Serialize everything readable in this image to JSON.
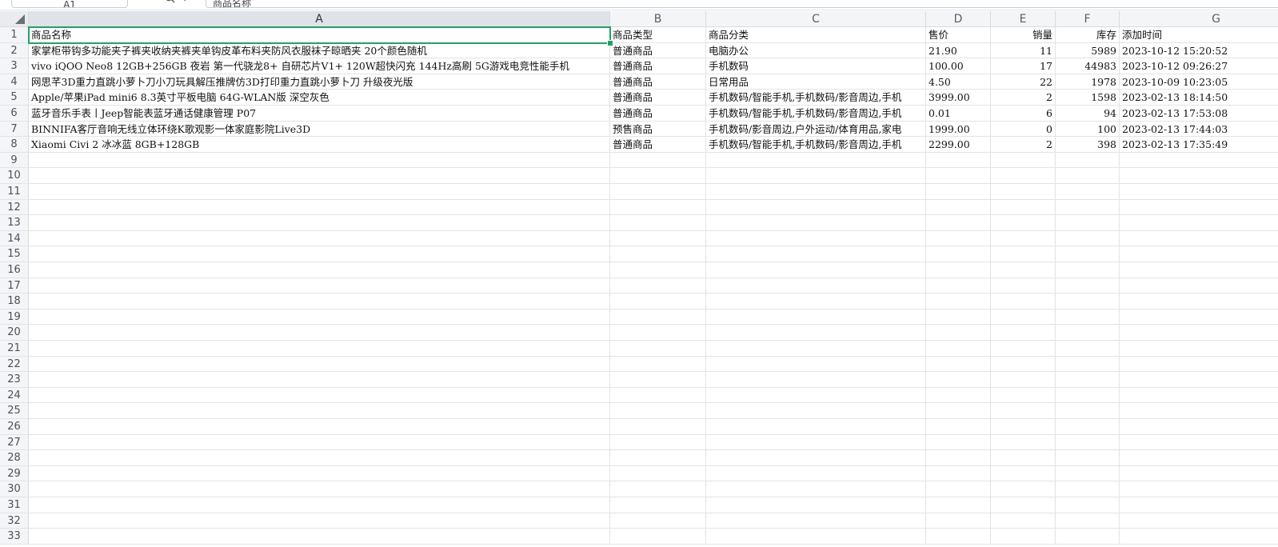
{
  "formula_bar": {
    "name_box": "A1",
    "fx_label": "fx",
    "value": "商品名称"
  },
  "columns": [
    "A",
    "B",
    "C",
    "D",
    "E",
    "F",
    "G"
  ],
  "rows": [
    [
      "商品名称",
      "商品类型",
      "商品分类",
      "售价",
      "销量",
      "库存",
      "添加时间"
    ],
    [
      "家掌柜带钩多功能夹子裤夹收纳夹裤夹单钩皮革布料夹防风衣服袜子晾晒夹 20个颜色随机",
      "普通商品",
      "电脑办公",
      "21.90",
      "11",
      "5989",
      "2023-10-12 15:20:52"
    ],
    [
      "vivo iQOO Neo8 12GB+256GB 夜岩 第一代骁龙8+ 自研芯片V1+ 120W超快闪充 144Hz高刷 5G游戏电竞性能手机",
      "普通商品",
      "手机数码",
      "100.00",
      "17",
      "44983",
      "2023-10-12 09:26:27"
    ],
    [
      "网思芊3D重力直跳小萝卜刀小刀玩具解压推牌仿3D打印重力直跳小萝卜刀 升级夜光版",
      "普通商品",
      "日常用品",
      "4.50",
      "22",
      "1978",
      "2023-10-09 10:23:05"
    ],
    [
      "Apple/苹果iPad mini6 8.3英寸平板电脑 64G-WLAN版 深空灰色",
      "普通商品",
      "手机数码/智能手机,手机数码/影音周边,手机",
      "3999.00",
      "2",
      "1598",
      "2023-02-13 18:14:50"
    ],
    [
      "蓝牙音乐手表丨Jeep智能表蓝牙通话健康管理 P07",
      "普通商品",
      "手机数码/智能手机,手机数码/影音周边,手机",
      "0.01",
      "6",
      "94",
      "2023-02-13 17:53:08"
    ],
    [
      "BINNIFA客厅音响无线立体环绕K歌观影一体家庭影院Live3D",
      "预售商品",
      "手机数码/影音周边,户外运动/体育用品,家电",
      "1999.00",
      "0",
      "100",
      "2023-02-13 17:44:03"
    ],
    [
      "Xiaomi Civi 2 冰冰蓝 8GB+128GB",
      "普通商品",
      "手机数码/智能手机,手机数码/影音周边,手机",
      "2299.00",
      "2",
      "398",
      "2023-02-13 17:35:49"
    ]
  ],
  "row_numbers": [
    "1",
    "2",
    "3",
    "4",
    "5",
    "6",
    "7",
    "8",
    "9",
    "10",
    "11",
    "12",
    "13",
    "14",
    "15",
    "16",
    "17",
    "18",
    "19",
    "20",
    "21",
    "22",
    "23",
    "24",
    "25",
    "26",
    "27",
    "28",
    "29",
    "30",
    "31",
    "32",
    "33"
  ],
  "numeric_columns": [
    4,
    5
  ],
  "selected_cell": "A1",
  "colors": {
    "selection": "#21a366",
    "header_bg": "#f4f5f7",
    "grid_line": "#e1e3e8"
  }
}
